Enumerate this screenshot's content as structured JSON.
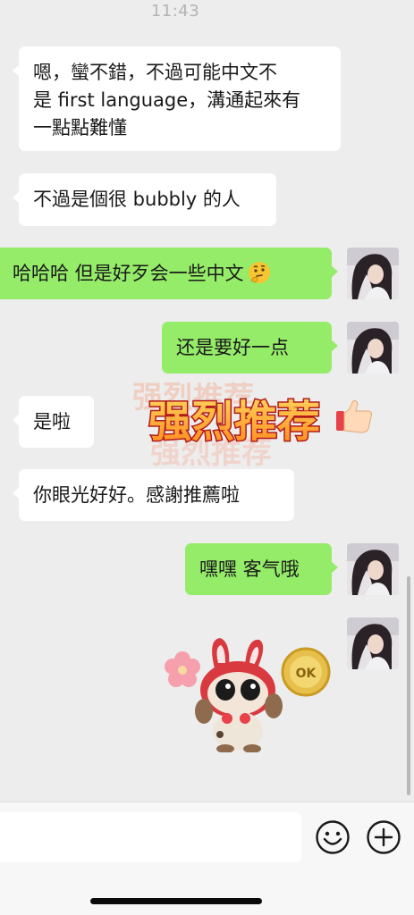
{
  "status": {
    "time": "11:43"
  },
  "messages": [
    {
      "side": "left",
      "lines": [
        "嗯，蠻不錯，不過可能中文不",
        "是 first language，溝通起來有",
        "一點點難懂"
      ]
    },
    {
      "side": "left",
      "lines": [
        "不過是個很 bubbly 的人"
      ]
    },
    {
      "side": "right",
      "text": "哈哈哈 但是好歹会一些中文",
      "emoji": "thinking-face-emoji"
    },
    {
      "side": "right",
      "text": "还是要好一点"
    },
    {
      "side": "left",
      "text": "是啦"
    },
    {
      "side": "left",
      "text": "你眼光好好。感謝推薦啦"
    },
    {
      "side": "right",
      "text": "嘿嘿 客气哦"
    }
  ],
  "stickers": {
    "stamp": {
      "text": "强烈推荐",
      "icon": "thumbs-up-emoji"
    },
    "rabbit": {
      "icon": "rabbit-cat-sticker",
      "coin_text": "OK"
    }
  },
  "input_bar": {
    "placeholder": "",
    "emoji_button": "smiley-icon",
    "add_button": "plus-circle-icon"
  },
  "colors": {
    "background": "#ededed",
    "self_bubble": "#95ec69",
    "other_bubble": "#ffffff"
  }
}
